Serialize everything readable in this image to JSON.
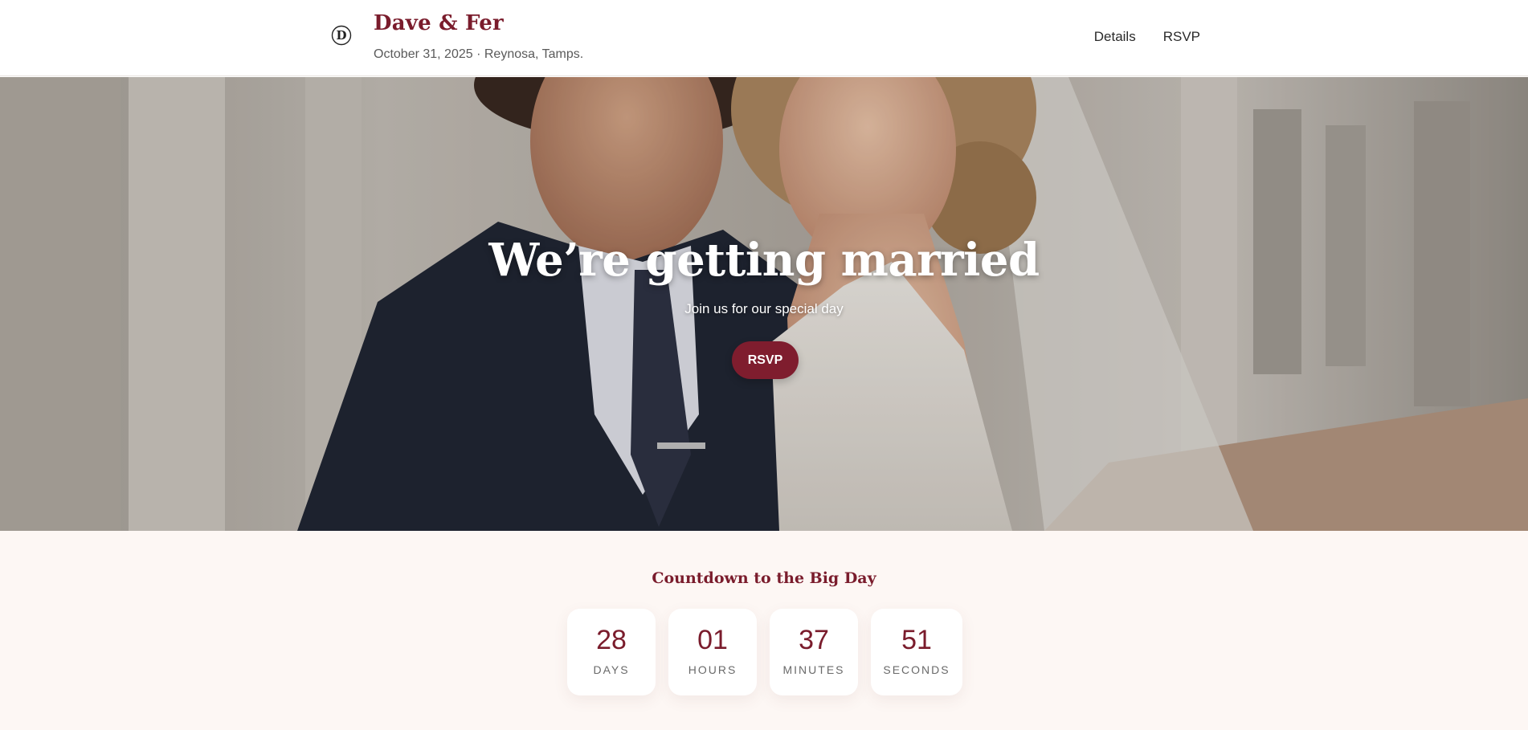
{
  "header": {
    "title": "Dave & Fer",
    "subtitle": "October 31, 2025 · Reynosa, Tamps.",
    "logo_letter": "D",
    "nav": [
      "Details",
      "RSVP"
    ]
  },
  "hero": {
    "title": "We’re getting married",
    "subtitle": "Join us for our special day",
    "button": "RSVP"
  },
  "countdown": {
    "title": "Countdown to the Big Day",
    "items": [
      {
        "value": "28",
        "label": "DAYS"
      },
      {
        "value": "01",
        "label": "HOURS"
      },
      {
        "value": "37",
        "label": "MINUTES"
      },
      {
        "value": "51",
        "label": "SECONDS"
      }
    ]
  },
  "colors": {
    "accent": "#7a1c2c",
    "button": "#7f1d2e",
    "countdown_bg": "#fdf7f4"
  }
}
